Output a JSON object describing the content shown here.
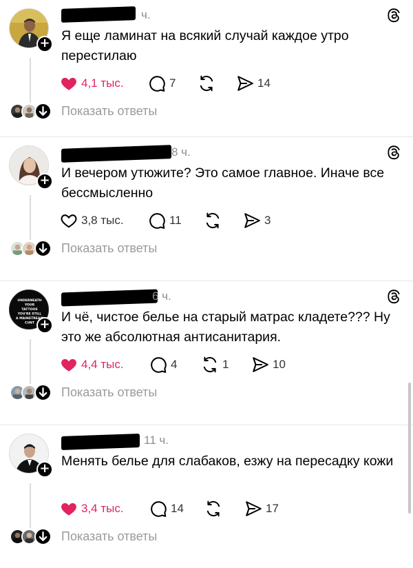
{
  "posts": [
    {
      "time": "ч.",
      "text": "Я еще ламинат на всякий случай каждое утро перестилаю",
      "liked": true,
      "likes": "4,1 тыс.",
      "comments": "7",
      "reposts": "",
      "shares": "14",
      "show_replies": "Показать ответы",
      "avatar_text": ""
    },
    {
      "time": "8 ч.",
      "text": "И вечером утюжите? Это самое главное. Иначе все бессмысленно",
      "liked": false,
      "likes": "3,8 тыс.",
      "comments": "11",
      "reposts": "",
      "shares": "3",
      "show_replies": "Показать ответы",
      "avatar_text": ""
    },
    {
      "time": "6 ч.",
      "text": "И чё, чистое белье на старый матрас кладете??? Ну это же абсолютная антисанитария.",
      "liked": true,
      "likes": "4,4 тыс.",
      "comments": "4",
      "reposts": "1",
      "shares": "10",
      "show_replies": "Показать ответы",
      "avatar_text": "UNDERNEATH YOUR TATTOOS YOU'RE STILL A MAINSTREAM CUNT"
    },
    {
      "time": "11 ч.",
      "text": "Менять белье для слабаков, езжу на пересадку кожи",
      "liked": true,
      "likes": "3,4 тыс.",
      "comments": "14",
      "reposts": "",
      "shares": "17",
      "show_replies": "Показать ответы",
      "avatar_text": ""
    }
  ],
  "colors": {
    "like": "#e0245e",
    "muted": "#8e8e8e",
    "text": "#000000"
  }
}
